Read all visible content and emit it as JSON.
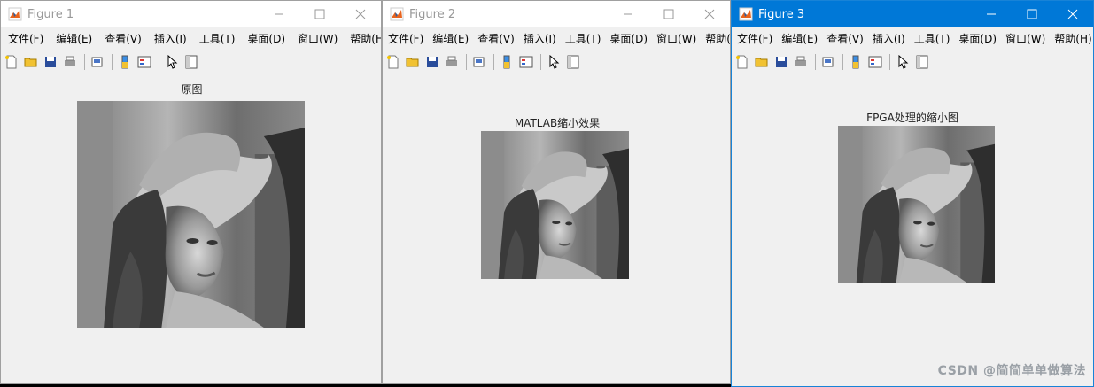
{
  "windows": [
    {
      "title": "Figure 1",
      "menu": [
        "文件(F)",
        "编辑(E)",
        "查看(V)",
        "插入(I)",
        "工具(T)",
        "桌面(D)",
        "窗口(W)",
        "帮助(H)"
      ],
      "more": "↘",
      "axis_title": "原图"
    },
    {
      "title": "Figure 2",
      "menu": [
        "文件(F)",
        "编辑(E)",
        "查看(V)",
        "插入(I)",
        "工具(T)",
        "桌面(D)",
        "窗口(W)",
        "帮助(H)"
      ],
      "more": "↘",
      "axis_title": "MATLAB缩小效果"
    },
    {
      "title": "Figure 3",
      "menu": [
        "文件(F)",
        "编辑(E)",
        "查看(V)",
        "插入(I)",
        "工具(T)",
        "桌面(D)",
        "窗口(W)",
        "帮助(H)"
      ],
      "more": "↘",
      "axis_title": "FPGA处理的缩小图"
    }
  ],
  "watermark": "CSDN @简简单单做算法",
  "toolbar_icons": [
    "new-figure-icon",
    "open-file-icon",
    "save-icon",
    "print-icon",
    "print-preview-icon",
    "colorbar-icon",
    "legend-icon",
    "edit-plot-arrow-icon",
    "property-inspector-icon"
  ],
  "colors": {
    "active_title": "#0078d7",
    "inactive_title_text": "#999999",
    "window_bg": "#f0f0f0"
  }
}
